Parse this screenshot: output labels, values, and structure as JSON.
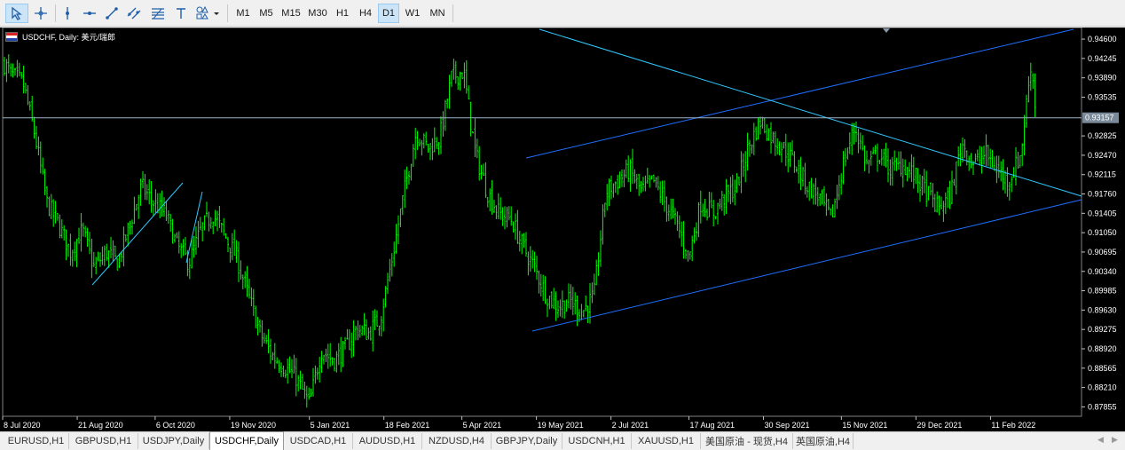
{
  "toolbar": {
    "tools": [
      {
        "name": "cursor-icon",
        "active": true
      },
      {
        "name": "crosshair-icon",
        "active": false
      },
      {
        "name": "vertical-line-icon",
        "active": false
      },
      {
        "name": "horizontal-line-icon",
        "active": false
      },
      {
        "name": "trendline-icon",
        "active": false
      },
      {
        "name": "channel-icon",
        "active": false
      },
      {
        "name": "fibonacci-icon",
        "active": false
      },
      {
        "name": "text-icon",
        "active": false
      },
      {
        "name": "shapes-icon",
        "active": false
      }
    ],
    "timeframes": [
      "M1",
      "M5",
      "M15",
      "M30",
      "H1",
      "H4",
      "D1",
      "W1",
      "MN"
    ],
    "active_timeframe": "D1"
  },
  "chart": {
    "title": "USDCHF, Daily:  美元/瑞郎",
    "current_price": "0.93157",
    "price_ticks": [
      "0.94600",
      "0.94245",
      "0.93890",
      "0.93535",
      "0.93157",
      "0.92825",
      "0.92470",
      "0.92115",
      "0.91760",
      "0.91405",
      "0.91050",
      "0.90695",
      "0.90340",
      "0.89985",
      "0.89630",
      "0.89275",
      "0.88920",
      "0.88565",
      "0.88210",
      "0.87855"
    ],
    "date_ticks": [
      "8 Jul 2020",
      "21 Aug 2020",
      "6 Oct 2020",
      "19 Nov 2020",
      "5 Jan 2021",
      "18 Feb 2021",
      "5 Apr 2021",
      "19 May 2021",
      "2 Jul 2021",
      "17 Aug 2021",
      "30 Sep 2021",
      "15 Nov 2021",
      "29 Dec 2021",
      "11 Feb 2022"
    ],
    "colors": {
      "background": "#000000",
      "candles": "#00ff00",
      "channel": "#1e6fff",
      "trendline": "#2fc8ff",
      "price_line": "#a0b4c8"
    }
  },
  "chart_data": {
    "type": "candlestick",
    "title": "USDCHF, Daily:  美元/瑞郎",
    "ylim": [
      0.8765,
      0.9478
    ],
    "current_price": 0.93157,
    "x_range": [
      "2020-07-08",
      "2022-03-10"
    ],
    "close_path": [
      [
        "2020-07-08",
        0.942
      ],
      [
        "2020-07-13",
        0.9395
      ],
      [
        "2020-07-20",
        0.938
      ],
      [
        "2020-07-27",
        0.9285
      ],
      [
        "2020-08-03",
        0.916
      ],
      [
        "2020-08-10",
        0.912
      ],
      [
        "2020-08-17",
        0.907
      ],
      [
        "2020-08-24",
        0.911
      ],
      [
        "2020-08-31",
        0.904
      ],
      [
        "2020-09-07",
        0.907
      ],
      [
        "2020-09-14",
        0.905
      ],
      [
        "2020-09-21",
        0.912
      ],
      [
        "2020-09-28",
        0.919
      ],
      [
        "2020-10-05",
        0.916
      ],
      [
        "2020-10-12",
        0.914
      ],
      [
        "2020-10-19",
        0.908
      ],
      [
        "2020-10-26",
        0.905
      ],
      [
        "2020-11-02",
        0.911
      ],
      [
        "2020-11-09",
        0.914
      ],
      [
        "2020-11-16",
        0.91
      ],
      [
        "2020-11-23",
        0.906
      ],
      [
        "2020-11-30",
        0.899
      ],
      [
        "2020-12-07",
        0.892
      ],
      [
        "2020-12-14",
        0.888
      ],
      [
        "2020-12-21",
        0.886
      ],
      [
        "2020-12-28",
        0.884
      ],
      [
        "2021-01-05",
        0.879
      ],
      [
        "2021-01-12",
        0.889
      ],
      [
        "2021-01-19",
        0.887
      ],
      [
        "2021-01-26",
        0.889
      ],
      [
        "2021-02-02",
        0.893
      ],
      [
        "2021-02-09",
        0.892
      ],
      [
        "2021-02-16",
        0.895
      ],
      [
        "2021-02-23",
        0.906
      ],
      [
        "2021-03-02",
        0.918
      ],
      [
        "2021-03-09",
        0.929
      ],
      [
        "2021-03-16",
        0.926
      ],
      [
        "2021-03-23",
        0.928
      ],
      [
        "2021-03-30",
        0.939
      ],
      [
        "2021-04-06",
        0.94
      ],
      [
        "2021-04-13",
        0.925
      ],
      [
        "2021-04-20",
        0.918
      ],
      [
        "2021-04-27",
        0.914
      ],
      [
        "2021-05-04",
        0.913
      ],
      [
        "2021-05-11",
        0.908
      ],
      [
        "2021-05-18",
        0.904
      ],
      [
        "2021-05-25",
        0.899
      ],
      [
        "2021-06-01",
        0.897
      ],
      [
        "2021-06-08",
        0.898
      ],
      [
        "2021-06-15",
        0.896
      ],
      [
        "2021-06-22",
        0.899
      ],
      [
        "2021-06-29",
        0.918
      ],
      [
        "2021-07-06",
        0.92
      ],
      [
        "2021-07-13",
        0.922
      ],
      [
        "2021-07-20",
        0.918
      ],
      [
        "2021-07-27",
        0.92
      ],
      [
        "2021-08-03",
        0.916
      ],
      [
        "2021-08-10",
        0.912
      ],
      [
        "2021-08-17",
        0.906
      ],
      [
        "2021-08-24",
        0.916
      ],
      [
        "2021-08-31",
        0.914
      ],
      [
        "2021-09-07",
        0.917
      ],
      [
        "2021-09-14",
        0.919
      ],
      [
        "2021-09-21",
        0.926
      ],
      [
        "2021-09-28",
        0.931
      ],
      [
        "2021-10-05",
        0.928
      ],
      [
        "2021-10-12",
        0.926
      ],
      [
        "2021-10-19",
        0.923
      ],
      [
        "2021-10-26",
        0.919
      ],
      [
        "2021-11-02",
        0.917
      ],
      [
        "2021-11-09",
        0.913
      ],
      [
        "2021-11-16",
        0.923
      ],
      [
        "2021-11-23",
        0.93
      ],
      [
        "2021-11-30",
        0.923
      ],
      [
        "2021-12-07",
        0.925
      ],
      [
        "2021-12-14",
        0.922
      ],
      [
        "2021-12-21",
        0.923
      ],
      [
        "2021-12-28",
        0.921
      ],
      [
        "2022-01-04",
        0.918
      ],
      [
        "2022-01-11",
        0.915
      ],
      [
        "2022-01-18",
        0.917
      ],
      [
        "2022-01-25",
        0.927
      ],
      [
        "2022-02-01",
        0.923
      ],
      [
        "2022-02-08",
        0.925
      ],
      [
        "2022-02-15",
        0.922
      ],
      [
        "2022-02-22",
        0.92
      ],
      [
        "2022-03-01",
        0.925
      ],
      [
        "2022-03-07",
        0.942
      ],
      [
        "2022-03-10",
        0.9316
      ]
    ]
  },
  "tabs": [
    {
      "label": "EURUSD,H1",
      "active": false
    },
    {
      "label": "GBPUSD,H1",
      "active": false
    },
    {
      "label": "USDJPY,Daily",
      "active": false
    },
    {
      "label": "USDCHF,Daily",
      "active": true
    },
    {
      "label": "USDCAD,H1",
      "active": false
    },
    {
      "label": "AUDUSD,H1",
      "active": false
    },
    {
      "label": "NZDUSD,H4",
      "active": false
    },
    {
      "label": "GBPJPY,Daily",
      "active": false
    },
    {
      "label": "USDCNH,H1",
      "active": false
    },
    {
      "label": "XAUUSD,H1",
      "active": false
    },
    {
      "label": "美国原油 - 现货,H4",
      "active": false
    },
    {
      "label": "英国原油,H4",
      "active": false
    }
  ],
  "tab_scroll": {
    "left": "◀",
    "right": "▶"
  }
}
